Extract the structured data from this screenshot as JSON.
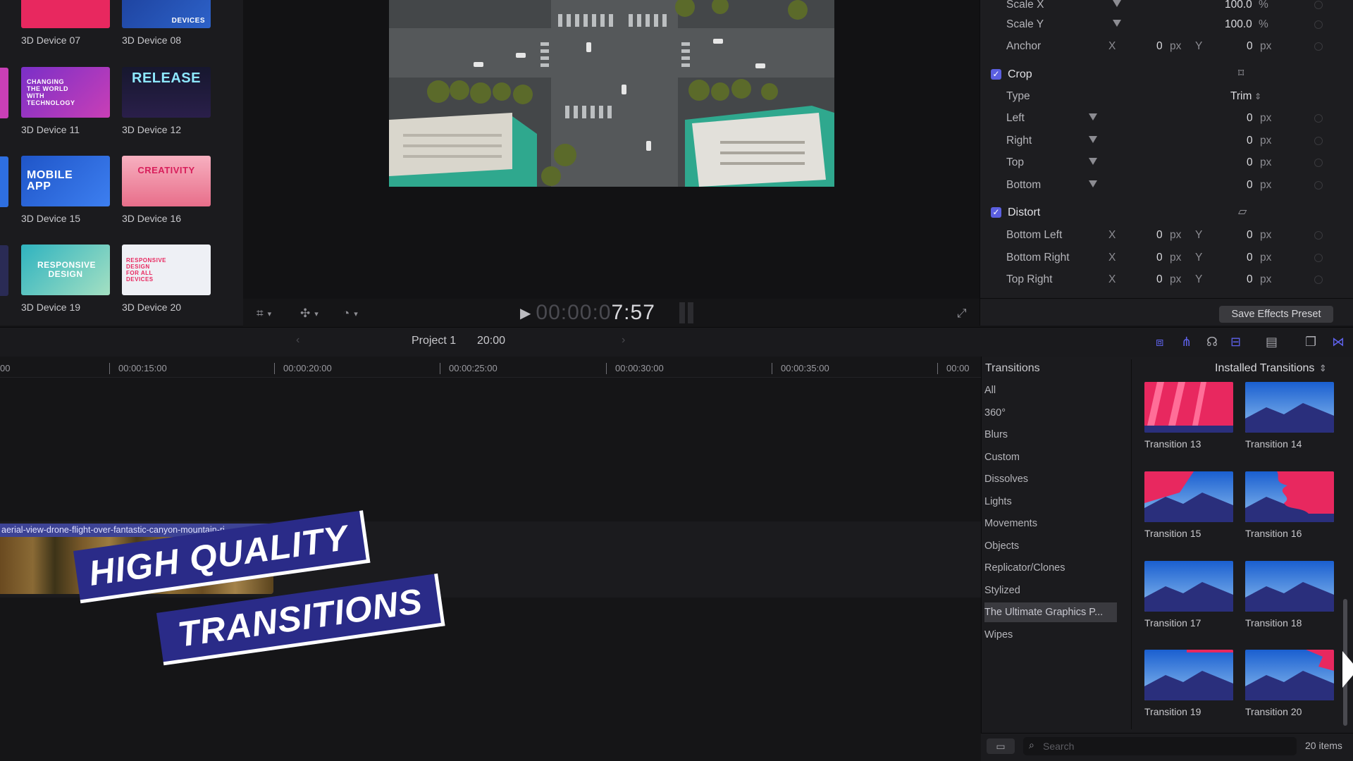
{
  "browser": {
    "tiles": [
      {
        "label": "3D Device 07",
        "thumb_text": "",
        "color": "#e8285f"
      },
      {
        "label": "3D Device 08",
        "thumb_text": "DEVICES",
        "color": "#2d62c9"
      },
      {
        "label": "3D Device 11",
        "thumb_text": "CHANGING THE WORLD WITH TECHNOLOGY",
        "color": "#8a3bd0"
      },
      {
        "label": "3D Device 12",
        "thumb_text": "RELEASE",
        "color": "#1c1d3a"
      },
      {
        "label": "3D Device 15",
        "thumb_text": "MOBILE APP",
        "color": "#2e6fe0"
      },
      {
        "label": "3D Device 16",
        "thumb_text": "CREATIVITY",
        "color": "#f08aa0"
      },
      {
        "label": "3D Device 19",
        "thumb_text": "RESPONSIVE DESIGN",
        "color": "#39c8b7"
      },
      {
        "label": "3D Device 20",
        "thumb_text": "RESPONSIVE DESIGN FOR ALL DEVICES",
        "color": "#eef0f5"
      }
    ]
  },
  "viewer": {
    "timecode_dim": "00:00:0",
    "timecode_bright": "7:57"
  },
  "inspector": {
    "scale_x": {
      "label": "Scale X",
      "value": "100.0",
      "unit": "%"
    },
    "scale_y": {
      "label": "Scale Y",
      "value": "100.0",
      "unit": "%"
    },
    "anchor": {
      "label": "Anchor",
      "x_axis": "X",
      "x": "0",
      "y_axis": "Y",
      "y": "0",
      "unit": "px"
    },
    "crop": {
      "title": "Crop",
      "type_label": "Type",
      "type_value": "Trim",
      "rows": [
        {
          "label": "Left",
          "value": "0",
          "unit": "px"
        },
        {
          "label": "Right",
          "value": "0",
          "unit": "px"
        },
        {
          "label": "Top",
          "value": "0",
          "unit": "px"
        },
        {
          "label": "Bottom",
          "value": "0",
          "unit": "px"
        }
      ]
    },
    "distort": {
      "title": "Distort",
      "rows": [
        {
          "label": "Bottom Left",
          "x": "0",
          "y": "0",
          "unit": "px"
        },
        {
          "label": "Bottom Right",
          "x": "0",
          "y": "0",
          "unit": "px"
        },
        {
          "label": "Top Right",
          "x": "0",
          "y": "0",
          "unit": "px"
        }
      ]
    },
    "save_preset": "Save Effects Preset"
  },
  "timeline": {
    "project_name": "Project 1",
    "project_duration": "20:00",
    "ruler": [
      "00",
      "00:00:15:00",
      "00:00:20:00",
      "00:00:25:00",
      "00:00:30:00",
      "00:00:35:00",
      "00:00"
    ],
    "clip_name": "aerial-view-drone-flight-over-fantastic-canyon-mountain-ri...",
    "banner_line1": "HIGH QUALITY",
    "banner_line2": "TRANSITIONS"
  },
  "transitions": {
    "title": "Transitions",
    "filter": "Installed Transitions",
    "categories": [
      "All",
      "360°",
      "Blurs",
      "Custom",
      "Dissolves",
      "Lights",
      "Movements",
      "Objects",
      "Replicator/Clones",
      "Stylized",
      "The Ultimate Graphics P...",
      "Wipes"
    ],
    "selected_category": "The Ultimate Graphics P...",
    "items": [
      {
        "label": "Transition 13",
        "style": "stripes"
      },
      {
        "label": "Transition 14",
        "style": "plain"
      },
      {
        "label": "Transition 15",
        "style": "left-flag"
      },
      {
        "label": "Transition 16",
        "style": "right-blob"
      },
      {
        "label": "Transition 17",
        "style": "plain"
      },
      {
        "label": "Transition 18",
        "style": "plain"
      },
      {
        "label": "Transition 19",
        "style": "top-line"
      },
      {
        "label": "Transition 20",
        "style": "corner"
      }
    ],
    "search_placeholder": "Search",
    "count": "20 items"
  },
  "colors": {
    "accent": "#5b5fe0",
    "transition_pink": "#e8285f",
    "banner_blue": "#2a2b88"
  },
  "icons": {
    "crop_tool": "crop-icon",
    "transform_tool": "transform-icon",
    "speed_tool": "speedometer-icon",
    "play": "play-icon",
    "fullscreen": "fullscreen-icon"
  }
}
